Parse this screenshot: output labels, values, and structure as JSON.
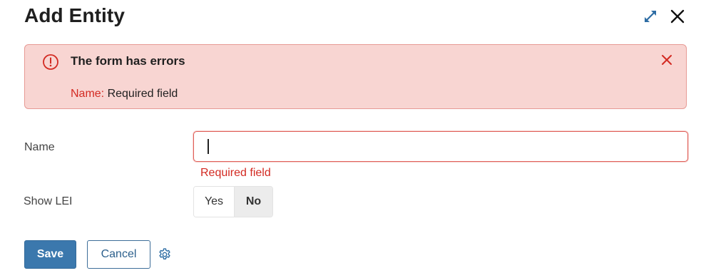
{
  "dialog": {
    "title": "Add Entity"
  },
  "header_icons": {
    "expand": "expand-icon",
    "close": "close-icon",
    "expand_color": "#2e6da4"
  },
  "error_banner": {
    "title": "The form has errors",
    "field_name": "Name:",
    "field_message": "Required field",
    "icon": "alert-circle-icon",
    "close_icon": "close-icon",
    "accent_color": "#d32a22",
    "background": "#f8d5d2"
  },
  "form": {
    "name": {
      "label": "Name",
      "value": "",
      "error": "Required field"
    },
    "show_lei": {
      "label": "Show LEI",
      "options": [
        "Yes",
        "No"
      ],
      "selected": "No"
    }
  },
  "actions": {
    "save_label": "Save",
    "cancel_label": "Cancel",
    "settings_icon": "gear-icon",
    "primary_color": "#3b78ad"
  }
}
